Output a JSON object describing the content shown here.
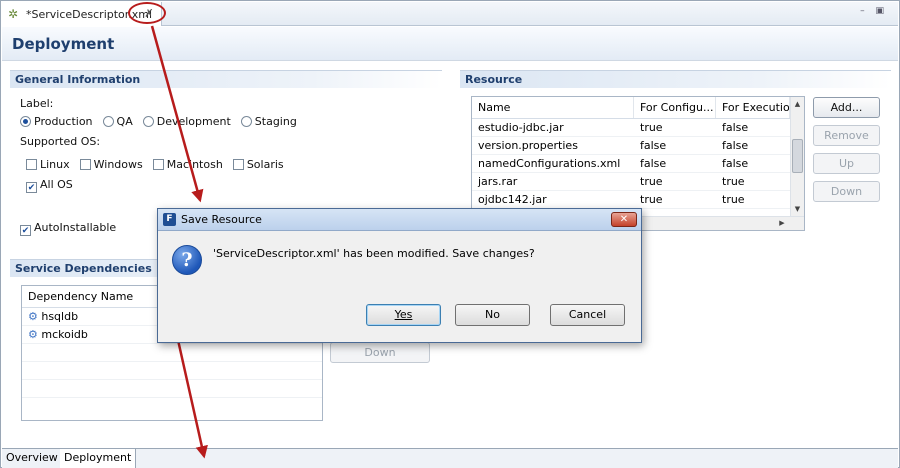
{
  "editor": {
    "tab_title": "*ServiceDescriptor.xml",
    "close_glyph": "✗",
    "win_controls": "– ▣"
  },
  "form": {
    "title": "Deployment"
  },
  "general": {
    "heading": "General Information",
    "label_caption": "Label:",
    "label_options": [
      "Production",
      "QA",
      "Development",
      "Staging"
    ],
    "label_selected": "Production",
    "os_caption": "Supported OS:",
    "os_options": [
      "Linux",
      "Windows",
      "Macintosh",
      "Solaris"
    ],
    "all_os": "All OS",
    "all_os_checked": true,
    "autoinstallable": "AutoInstallable",
    "autoinstallable_checked": true
  },
  "resource": {
    "heading": "Resource",
    "columns": [
      "Name",
      "For Configu...",
      "For Execution"
    ],
    "rows": [
      [
        "estudio-jdbc.jar",
        "true",
        "false"
      ],
      [
        "version.properties",
        "false",
        "false"
      ],
      [
        "namedConfigurations.xml",
        "false",
        "false"
      ],
      [
        "jars.rar",
        "true",
        "true"
      ],
      [
        "ojdbc142.jar",
        "true",
        "true"
      ]
    ],
    "buttons": {
      "add": "Add...",
      "remove": "Remove",
      "up": "Up",
      "down": "Down"
    }
  },
  "dependencies": {
    "heading": "Service Dependencies",
    "column": "Dependency Name",
    "rows": [
      "hsqldb",
      "mckoidb"
    ],
    "down_button": "Down"
  },
  "dialog": {
    "title": "Save Resource",
    "icon_letter": "F",
    "question_glyph": "?",
    "close_glyph": "✕",
    "message": "'ServiceDescriptor.xml' has been modified. Save changes?",
    "yes": "Yes",
    "no": "No",
    "cancel": "Cancel"
  },
  "bottom_tabs": [
    "Overview",
    "Deployment"
  ],
  "colors": {
    "accent": "#1f3f6e",
    "annotation": "#b71c1c",
    "dialog_close": "#c4412a"
  }
}
